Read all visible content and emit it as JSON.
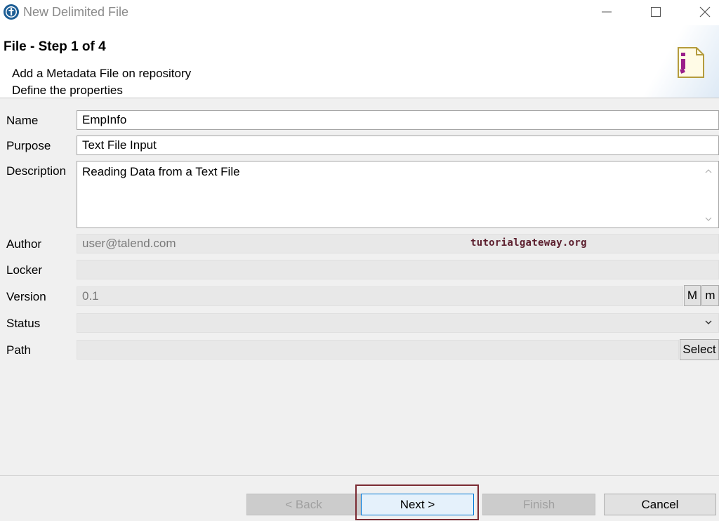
{
  "window": {
    "title": "New Delimited File",
    "app_icon": "talend-icon",
    "controls": [
      "minimize-icon",
      "maximize-icon",
      "close-icon"
    ]
  },
  "header": {
    "step_title": "File - Step 1 of 4",
    "subtitle_1": "Add a Metadata File on repository",
    "subtitle_2": "Define the properties",
    "icon": "delimited-file-icon"
  },
  "form": {
    "name": {
      "label": "Name",
      "value": "EmpInfo"
    },
    "purpose": {
      "label": "Purpose",
      "value": "Text File Input"
    },
    "description": {
      "label": "Description",
      "value": "Reading Data from a Text File"
    },
    "author": {
      "label": "Author",
      "value": "user@talend.com"
    },
    "locker": {
      "label": "Locker",
      "value": ""
    },
    "version": {
      "label": "Version",
      "value": "0.1",
      "major_btn": "M",
      "minor_btn": "m"
    },
    "status": {
      "label": "Status",
      "value": ""
    },
    "path": {
      "label": "Path",
      "value": "",
      "select_btn": "Select"
    }
  },
  "watermark": "tutorialgateway.org",
  "buttons": {
    "back": "< Back",
    "next": "Next >",
    "finish": "Finish",
    "cancel": "Cancel"
  },
  "colors": {
    "accent": "#0078d7",
    "highlight": "#7b2b33",
    "icon_magenta": "#9b1f8a"
  }
}
